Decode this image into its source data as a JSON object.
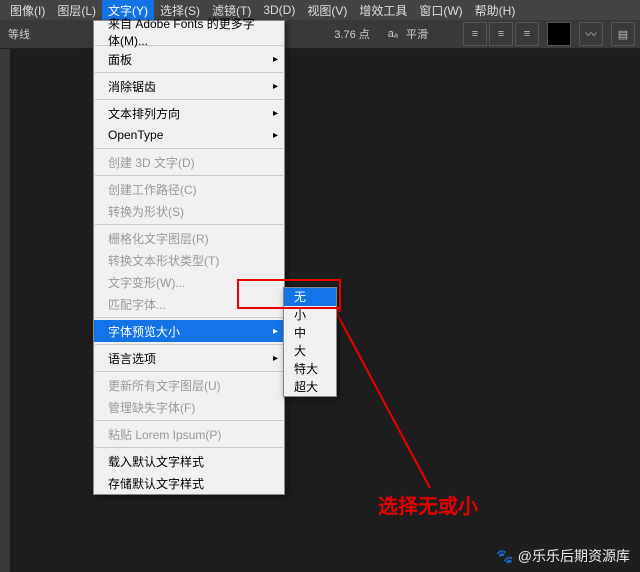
{
  "menubar": {
    "items": [
      {
        "label": "图像(I)"
      },
      {
        "label": "图层(L)"
      },
      {
        "label": "文字(Y)"
      },
      {
        "label": "选择(S)"
      },
      {
        "label": "滤镜(T)"
      },
      {
        "label": "3D(D)"
      },
      {
        "label": "视图(V)"
      },
      {
        "label": "增效工具"
      },
      {
        "label": "窗口(W)"
      },
      {
        "label": "帮助(H)"
      }
    ],
    "active_index": 2
  },
  "optionsbar": {
    "left_label": "等线",
    "size": "3.76 点",
    "aa_glyph": "aₐ",
    "aa_value": "平滑"
  },
  "type_menu": {
    "items": [
      {
        "label": "来自 Adobe Fonts 的更多字体(M)...",
        "has_sub": false
      },
      {
        "sep": true
      },
      {
        "label": "面板",
        "has_sub": true
      },
      {
        "sep": true
      },
      {
        "label": "消除锯齿",
        "has_sub": true
      },
      {
        "sep": true
      },
      {
        "label": "文本排列方向",
        "has_sub": true
      },
      {
        "label": "OpenType",
        "has_sub": true
      },
      {
        "sep": true
      },
      {
        "label": "创建 3D 文字(D)",
        "has_sub": false,
        "disabled": true
      },
      {
        "sep": true
      },
      {
        "label": "创建工作路径(C)",
        "has_sub": false,
        "disabled": true
      },
      {
        "label": "转换为形状(S)",
        "has_sub": false,
        "disabled": true
      },
      {
        "sep": true
      },
      {
        "label": "栅格化文字图层(R)",
        "has_sub": false,
        "disabled": true
      },
      {
        "label": "转换文本形状类型(T)",
        "has_sub": false,
        "disabled": true
      },
      {
        "label": "文字变形(W)...",
        "has_sub": false,
        "disabled": true
      },
      {
        "label": "匹配字体...",
        "has_sub": false,
        "disabled": true
      },
      {
        "sep": true
      },
      {
        "label": "字体预览大小",
        "has_sub": true,
        "hl": true
      },
      {
        "sep": true
      },
      {
        "label": "语言选项",
        "has_sub": true
      },
      {
        "sep": true
      },
      {
        "label": "更新所有文字图层(U)",
        "has_sub": false,
        "disabled": true
      },
      {
        "label": "管理缺失字体(F)",
        "has_sub": false,
        "disabled": true
      },
      {
        "sep": true
      },
      {
        "label": "粘贴 Lorem Ipsum(P)",
        "has_sub": false,
        "disabled": true
      },
      {
        "sep": true
      },
      {
        "label": "载入默认文字样式",
        "has_sub": false
      },
      {
        "label": "存储默认文字样式",
        "has_sub": false
      }
    ]
  },
  "submenu": {
    "items": [
      {
        "label": "无",
        "hl": true
      },
      {
        "label": "小"
      },
      {
        "label": "中"
      },
      {
        "label": "大"
      },
      {
        "label": "特大"
      },
      {
        "label": "超大"
      }
    ]
  },
  "annotation": {
    "text": "选择无或小"
  },
  "watermark": {
    "text": "@乐乐后期资源库",
    "paw": "🐾"
  }
}
